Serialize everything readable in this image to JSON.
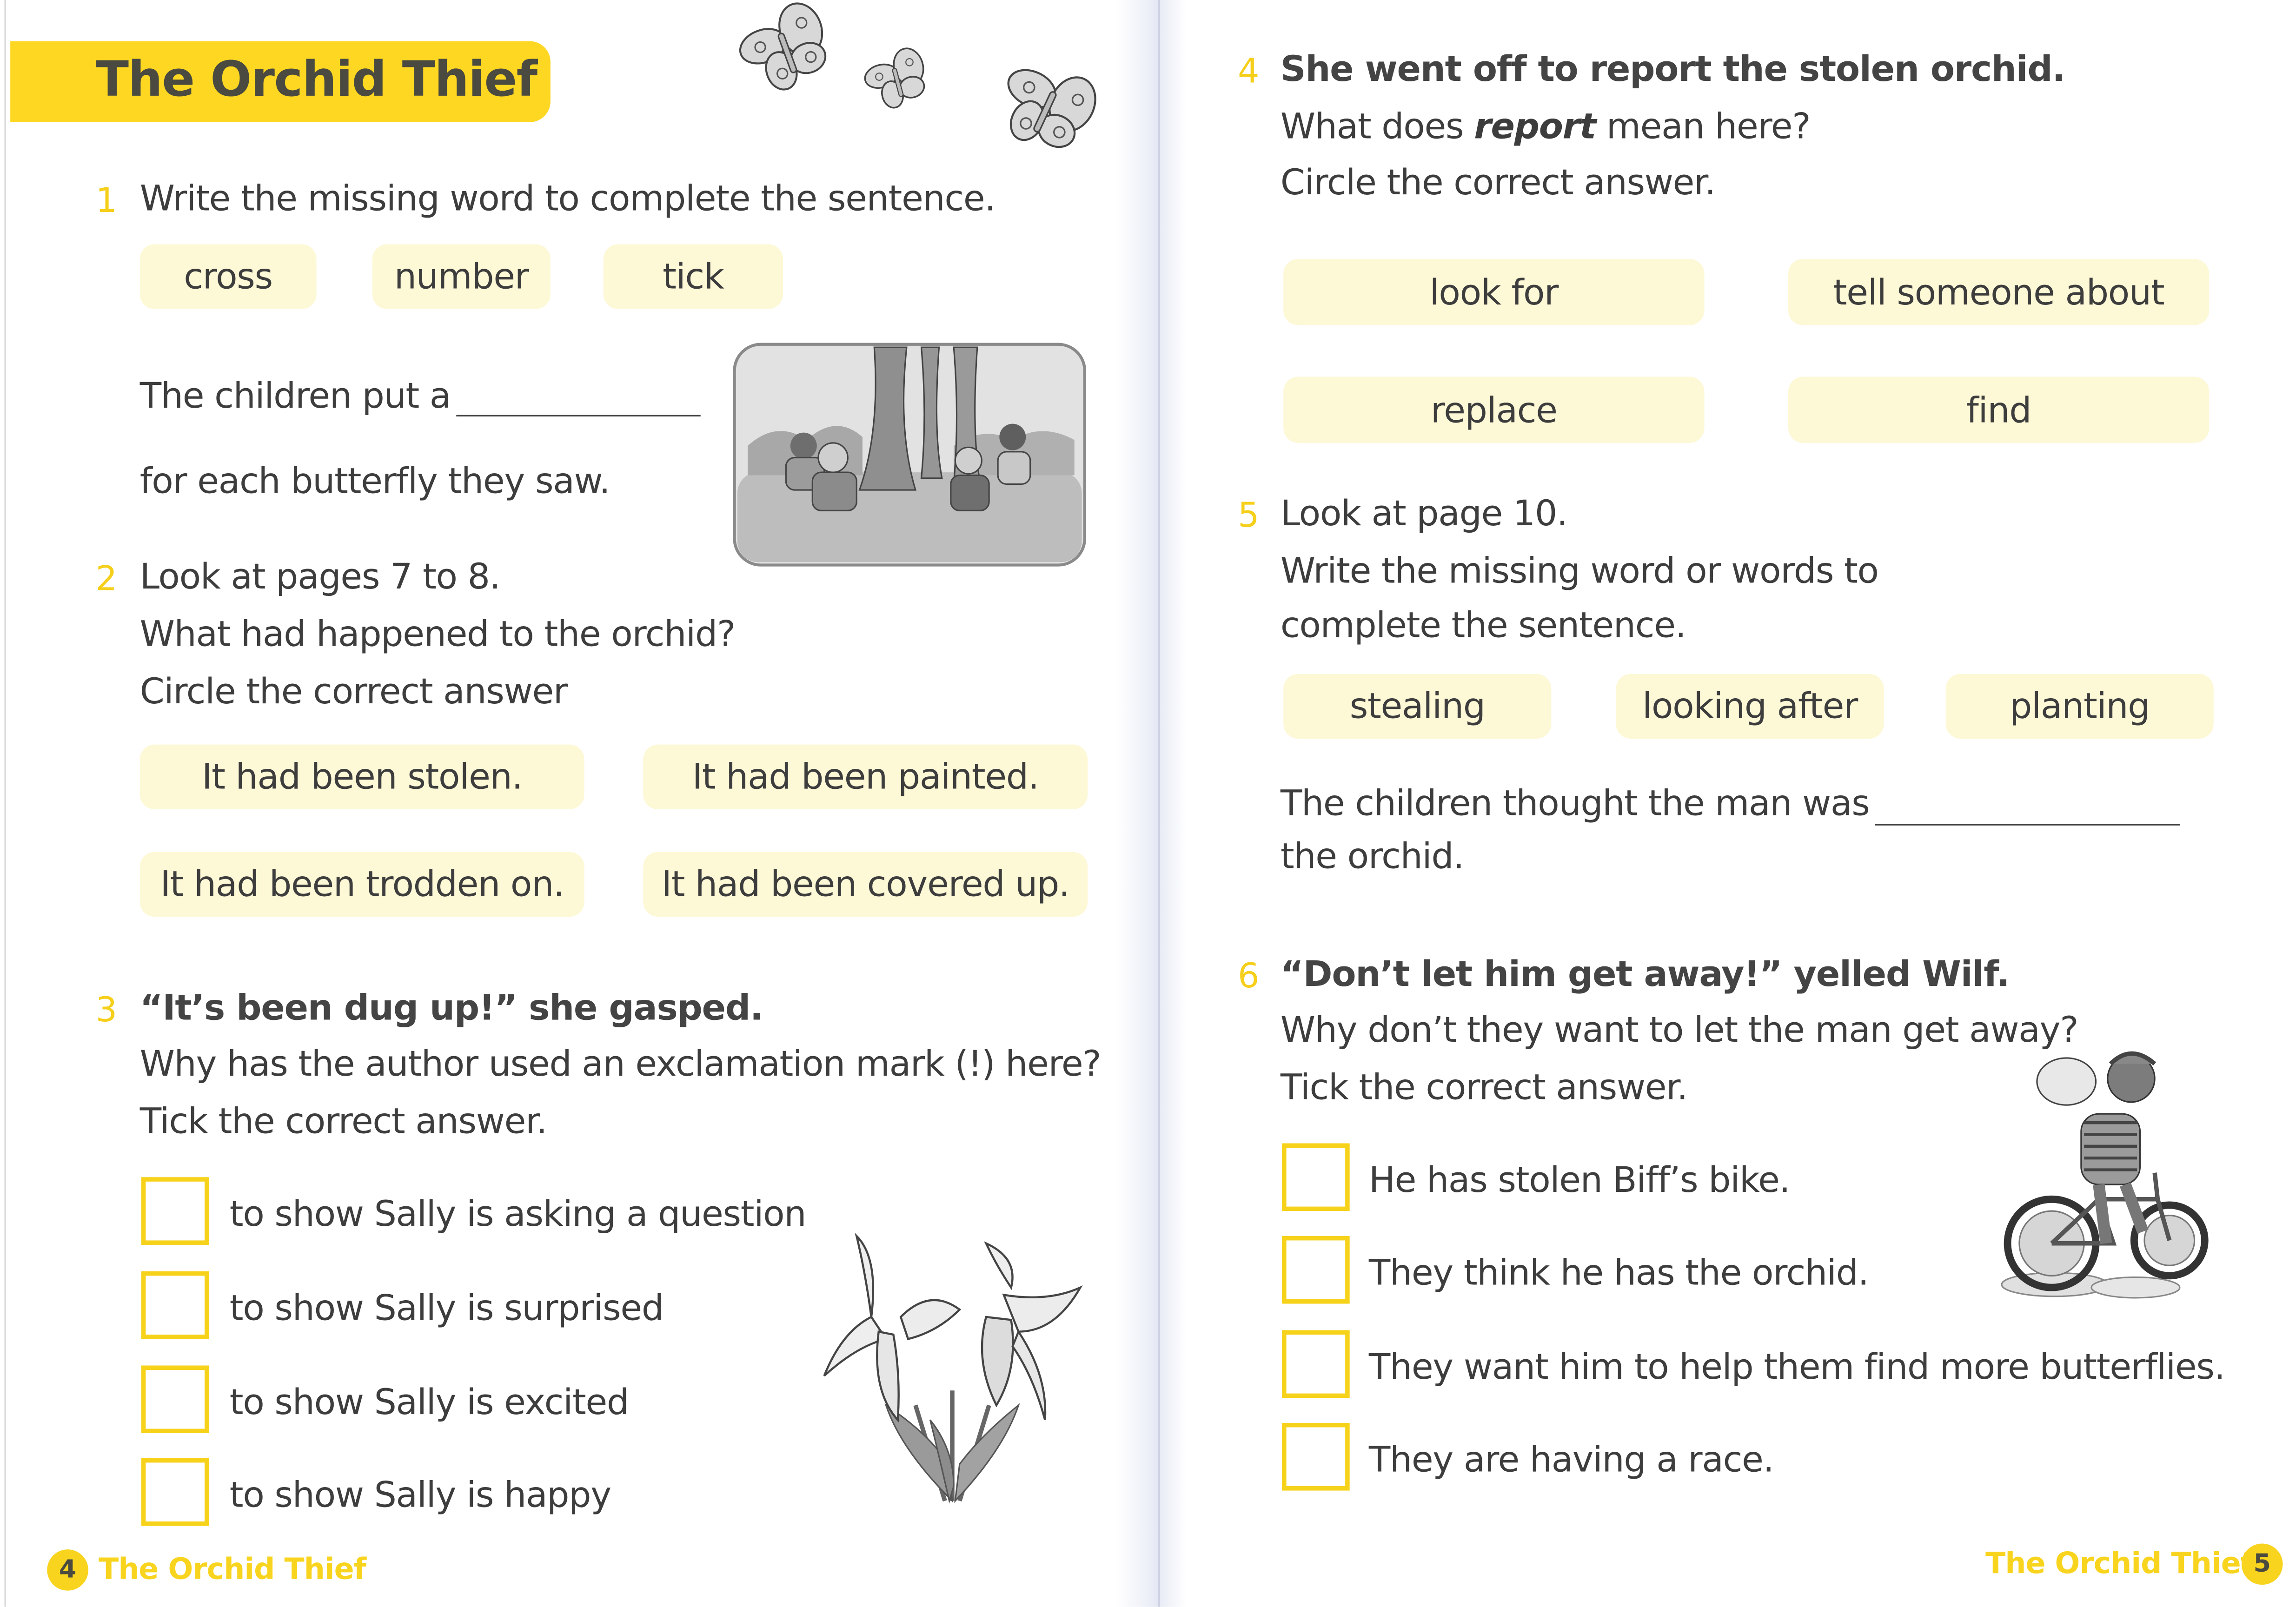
{
  "left_page": {
    "title": "The Orchid Thief",
    "page_number": "4",
    "footer_title": "The Orchid Thief",
    "q1": {
      "number": "1",
      "prompt": "Write the missing word to complete the sentence.",
      "options": [
        "cross",
        "number",
        "tick"
      ],
      "sentence_part1": "The children put a",
      "sentence_part2": "for each butterfly they saw."
    },
    "q2": {
      "number": "2",
      "line1": "Look at pages 7 to 8.",
      "line2": "What had happened to the orchid?",
      "line3": "Circle the correct answer",
      "options": [
        "It had been stolen.",
        "It had been painted.",
        "It had been trodden on.",
        "It had been covered up."
      ]
    },
    "q3": {
      "number": "3",
      "quote": "“It’s been dug up!” she gasped.",
      "line2": "Why has the author used an exclamation mark (!) here?",
      "line3": "Tick the correct answer.",
      "options": [
        "to show Sally is asking a question",
        "to show Sally is surprised",
        "to show Sally is excited",
        "to show Sally is happy"
      ]
    }
  },
  "right_page": {
    "page_number": "5",
    "footer_title": "The Orchid Thief",
    "q4": {
      "number": "4",
      "quote": "She went off to report the stolen orchid.",
      "line2_before": "What does",
      "line2_emph": "report",
      "line2_after": "mean here?",
      "line3": "Circle the correct answer.",
      "options": [
        "look for",
        "tell someone about",
        "replace",
        "find"
      ]
    },
    "q5": {
      "number": "5",
      "line1": "Look at page 10.",
      "line2": "Write the missing word or words to",
      "line3": "complete the sentence.",
      "options": [
        "stealing",
        "looking after",
        "planting"
      ],
      "sentence_part1": "The children thought the man was",
      "sentence_part2": "the orchid."
    },
    "q6": {
      "number": "6",
      "quote": "“Don’t let him get away!” yelled Wilf.",
      "line2": "Why don’t they want to let the man get away?",
      "line3": "Tick the correct answer.",
      "options": [
        "He has stolen Biff’s bike.",
        "They think he has the orchid.",
        "They want him to help them find more butterflies.",
        "They are having a race."
      ]
    }
  },
  "colors": {
    "accent_yellow": "#fdd721",
    "pill_cream": "#fdf8d6",
    "text": "#3d3d3d"
  }
}
